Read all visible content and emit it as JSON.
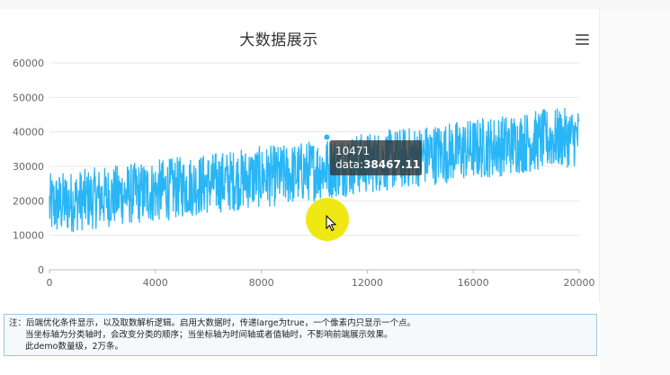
{
  "title": "大数据展示",
  "chart_data": {
    "type": "line",
    "title": "大数据展示",
    "xlabel": "",
    "ylabel": "",
    "xlim": [
      0,
      20000
    ],
    "ylim": [
      0,
      60000
    ],
    "x_ticks": [
      "0",
      "4000",
      "8000",
      "12000",
      "16000",
      "20000"
    ],
    "y_ticks": [
      "0",
      "10000",
      "20000",
      "30000",
      "40000",
      "50000",
      "60000"
    ],
    "series": [
      {
        "color": "#29b6f6",
        "points_count": 20000,
        "envelope_note_free": true,
        "x_sampled": [
          0,
          1000,
          2000,
          3000,
          4000,
          5000,
          6000,
          7000,
          8000,
          9000,
          10000,
          11000,
          12000,
          13000,
          14000,
          15000,
          16000,
          17000,
          18000,
          19000,
          20000
        ],
        "y_low": [
          9000,
          11000,
          12000,
          13000,
          13500,
          15000,
          16000,
          17000,
          18000,
          18500,
          20000,
          21000,
          22000,
          23000,
          24000,
          25000,
          26000,
          27000,
          28000,
          29000,
          30000
        ],
        "y_high": [
          28000,
          29000,
          30000,
          31000,
          32000,
          33000,
          34000,
          35000,
          36000,
          36500,
          38000,
          39000,
          40000,
          41000,
          42000,
          43000,
          44000,
          45000,
          46000,
          47000,
          47000
        ]
      }
    ],
    "highlight": {
      "x": 10471,
      "y": 38467.11
    },
    "grid": true
  },
  "tooltip": {
    "index": "10471",
    "label": "data:",
    "value": "38467.11"
  },
  "note": {
    "line1": "注：后端优化条件显示，以及取数解析逻辑。启用大数据时，传递large为true，一个像素内只显示一个点。",
    "line2": "当坐标轴为分类轴时，会改变分类的顺序；当坐标轴为时间轴或者值轴时，不影响前端展示效果。",
    "line3": "此demo数量级，2万条。"
  }
}
